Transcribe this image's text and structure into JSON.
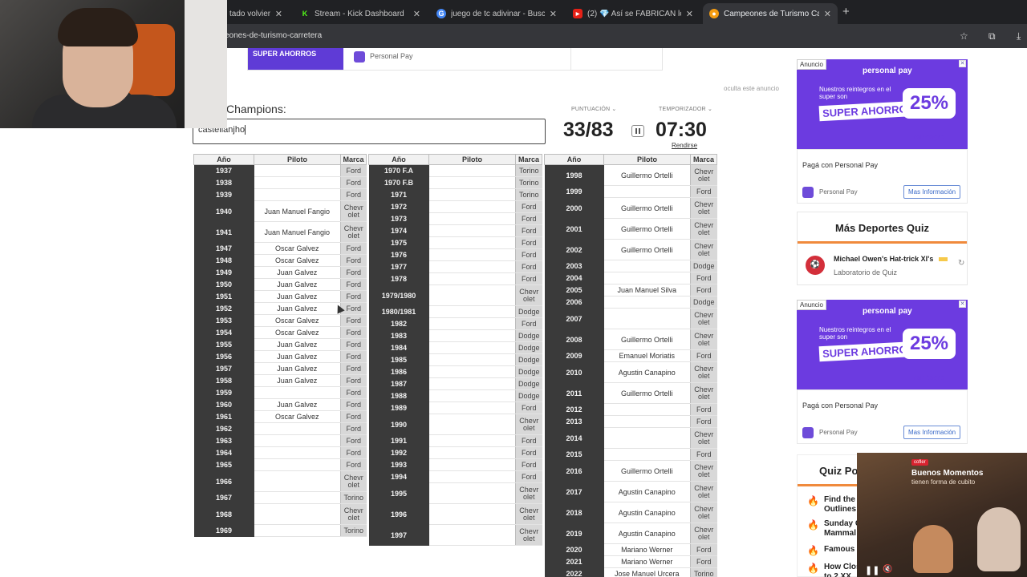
{
  "browser": {
    "tabs": [
      {
        "label": "tado volviend",
        "active": false,
        "icon": "music-icon"
      },
      {
        "label": "Stream - Kick Dashboard",
        "active": false,
        "icon": "kick-icon"
      },
      {
        "label": "juego de tc adivinar - Buscar co",
        "active": false,
        "icon": "google-icon"
      },
      {
        "label": "(2) 💎 Así se FABRICAN los CO",
        "active": false,
        "icon": "youtube-icon"
      },
      {
        "label": "Campeones de Turismo Carrete",
        "active": true,
        "icon": "sporcle-icon"
      }
    ],
    "url": "eones-de-turismo-carretera"
  },
  "top_ad": {
    "image_text": "SUPER AHORROS",
    "brand": "Personal Pay",
    "hide_label": "oculta este anuncio"
  },
  "quiz": {
    "prompt": "Champions:",
    "answer_value": "castellanjho",
    "score_label": "PUNTUACIÓN",
    "score": "33/83",
    "timer_label": "TEMPORIZADOR",
    "timer": "07:30",
    "give_up": "Rendirse",
    "headers": {
      "year": "Año",
      "driver": "Piloto",
      "brand": "Marca"
    },
    "tables": [
      [
        {
          "y": "1937",
          "d": "",
          "b": "Ford",
          "h": 15
        },
        {
          "y": "1938",
          "d": "",
          "b": "Ford",
          "h": 15
        },
        {
          "y": "1939",
          "d": "",
          "b": "Ford",
          "h": 15
        },
        {
          "y": "1940",
          "d": "Juan Manuel Fangio",
          "b": "Chevr olet",
          "h": 26
        },
        {
          "y": "1941",
          "d": "Juan Manuel Fangio",
          "b": "Chevr olet",
          "h": 26
        },
        {
          "y": "1947",
          "d": "Oscar Galvez",
          "b": "Ford",
          "h": 15
        },
        {
          "y": "1948",
          "d": "Oscar Galvez",
          "b": "Ford",
          "h": 15
        },
        {
          "y": "1949",
          "d": "Juan Galvez",
          "b": "Ford",
          "h": 15
        },
        {
          "y": "1950",
          "d": "Juan Galvez",
          "b": "Ford",
          "h": 15
        },
        {
          "y": "1951",
          "d": "Juan Galvez",
          "b": "Ford",
          "h": 15
        },
        {
          "y": "1952",
          "d": "Juan Galvez",
          "b": "Ford",
          "h": 15
        },
        {
          "y": "1953",
          "d": "Oscar Galvez",
          "b": "Ford",
          "h": 15
        },
        {
          "y": "1954",
          "d": "Oscar Galvez",
          "b": "Ford",
          "h": 15
        },
        {
          "y": "1955",
          "d": "Juan Galvez",
          "b": "Ford",
          "h": 15
        },
        {
          "y": "1956",
          "d": "Juan Galvez",
          "b": "Ford",
          "h": 15
        },
        {
          "y": "1957",
          "d": "Juan Galvez",
          "b": "Ford",
          "h": 15
        },
        {
          "y": "1958",
          "d": "Juan Galvez",
          "b": "Ford",
          "h": 15
        },
        {
          "y": "1959",
          "d": "",
          "b": "Ford",
          "h": 15
        },
        {
          "y": "1960",
          "d": "Juan Galvez",
          "b": "Ford",
          "h": 15
        },
        {
          "y": "1961",
          "d": "Oscar Galvez",
          "b": "Ford",
          "h": 15
        },
        {
          "y": "1962",
          "d": "",
          "b": "Ford",
          "h": 15
        },
        {
          "y": "1963",
          "d": "",
          "b": "Ford",
          "h": 15
        },
        {
          "y": "1964",
          "d": "",
          "b": "Ford",
          "h": 15
        },
        {
          "y": "1965",
          "d": "",
          "b": "Ford",
          "h": 15
        },
        {
          "y": "1966",
          "d": "",
          "b": "Chevr olet",
          "h": 26
        },
        {
          "y": "1967",
          "d": "",
          "b": "Torino",
          "h": 15
        },
        {
          "y": "1968",
          "d": "",
          "b": "Chevr olet",
          "h": 26
        },
        {
          "y": "1969",
          "d": "",
          "b": "Torino",
          "h": 15
        }
      ],
      [
        {
          "y": "1970 F.A",
          "d": "",
          "b": "Torino",
          "h": 15
        },
        {
          "y": "1970 F.B",
          "d": "",
          "b": "Torino",
          "h": 15
        },
        {
          "y": "1971",
          "d": "",
          "b": "Torino",
          "h": 15
        },
        {
          "y": "1972",
          "d": "",
          "b": "Ford",
          "h": 15
        },
        {
          "y": "1973",
          "d": "",
          "b": "Ford",
          "h": 15
        },
        {
          "y": "1974",
          "d": "",
          "b": "Ford",
          "h": 15
        },
        {
          "y": "1975",
          "d": "",
          "b": "Ford",
          "h": 15
        },
        {
          "y": "1976",
          "d": "",
          "b": "Ford",
          "h": 15
        },
        {
          "y": "1977",
          "d": "",
          "b": "Ford",
          "h": 15
        },
        {
          "y": "1978",
          "d": "",
          "b": "Ford",
          "h": 15
        },
        {
          "y": "1979/1980",
          "d": "",
          "b": "Chevr olet",
          "h": 26
        },
        {
          "y": "1980/1981",
          "d": "",
          "b": "Dodge",
          "h": 15
        },
        {
          "y": "1982",
          "d": "",
          "b": "Ford",
          "h": 15
        },
        {
          "y": "1983",
          "d": "",
          "b": "Dodge",
          "h": 15
        },
        {
          "y": "1984",
          "d": "",
          "b": "Dodge",
          "h": 15
        },
        {
          "y": "1985",
          "d": "",
          "b": "Dodge",
          "h": 15
        },
        {
          "y": "1986",
          "d": "",
          "b": "Dodge",
          "h": 15
        },
        {
          "y": "1987",
          "d": "",
          "b": "Dodge",
          "h": 15
        },
        {
          "y": "1988",
          "d": "",
          "b": "Dodge",
          "h": 15
        },
        {
          "y": "1989",
          "d": "",
          "b": "Ford",
          "h": 15
        },
        {
          "y": "1990",
          "d": "",
          "b": "Chevr olet",
          "h": 26
        },
        {
          "y": "1991",
          "d": "",
          "b": "Ford",
          "h": 15
        },
        {
          "y": "1992",
          "d": "",
          "b": "Ford",
          "h": 15
        },
        {
          "y": "1993",
          "d": "",
          "b": "Ford",
          "h": 15
        },
        {
          "y": "1994",
          "d": "",
          "b": "Ford",
          "h": 15
        },
        {
          "y": "1995",
          "d": "",
          "b": "Chevr olet",
          "h": 26
        },
        {
          "y": "1996",
          "d": "",
          "b": "Chevr olet",
          "h": 26
        },
        {
          "y": "1997",
          "d": "",
          "b": "Chevr olet",
          "h": 26
        }
      ],
      [
        {
          "y": "1998",
          "d": "Guillermo Ortelli",
          "b": "Chevr olet",
          "h": 26
        },
        {
          "y": "1999",
          "d": "",
          "b": "Ford",
          "h": 15
        },
        {
          "y": "2000",
          "d": "Guillermo Ortelli",
          "b": "Chevr olet",
          "h": 26
        },
        {
          "y": "2001",
          "d": "Guillermo Ortelli",
          "b": "Chevr olet",
          "h": 26
        },
        {
          "y": "2002",
          "d": "Guillermo Ortelli",
          "b": "Chevr olet",
          "h": 26
        },
        {
          "y": "2003",
          "d": "",
          "b": "Dodge",
          "h": 15
        },
        {
          "y": "2004",
          "d": "",
          "b": "Ford",
          "h": 15
        },
        {
          "y": "2005",
          "d": "Juan Manuel Silva",
          "b": "Ford",
          "h": 15
        },
        {
          "y": "2006",
          "d": "",
          "b": "Dodge",
          "h": 15
        },
        {
          "y": "2007",
          "d": "",
          "b": "Chevr olet",
          "h": 26
        },
        {
          "y": "2008",
          "d": "Guillermo Ortelli",
          "b": "Chevr olet",
          "h": 26
        },
        {
          "y": "2009",
          "d": "Emanuel Moriatis",
          "b": "Ford",
          "h": 15
        },
        {
          "y": "2010",
          "d": "Agustin Canapino",
          "b": "Chevr olet",
          "h": 26
        },
        {
          "y": "2011",
          "d": "Guillermo Ortelli",
          "b": "Chevr olet",
          "h": 26
        },
        {
          "y": "2012",
          "d": "",
          "b": "Ford",
          "h": 15
        },
        {
          "y": "2013",
          "d": "",
          "b": "Ford",
          "h": 15
        },
        {
          "y": "2014",
          "d": "",
          "b": "Chevr olet",
          "h": 26
        },
        {
          "y": "2015",
          "d": "",
          "b": "Ford",
          "h": 15
        },
        {
          "y": "2016",
          "d": "Guillermo Ortelli",
          "b": "Chevr olet",
          "h": 26
        },
        {
          "y": "2017",
          "d": "Agustin Canapino",
          "b": "Chevr olet",
          "h": 26
        },
        {
          "y": "2018",
          "d": "Agustin Canapino",
          "b": "Chevr olet",
          "h": 26
        },
        {
          "y": "2019",
          "d": "Agustin Canapino",
          "b": "Chevr olet",
          "h": 26
        },
        {
          "y": "2020",
          "d": "Mariano Werner",
          "b": "Ford",
          "h": 15
        },
        {
          "y": "2021",
          "d": "Mariano Werner",
          "b": "Ford",
          "h": 15
        },
        {
          "y": "2022",
          "d": "Jose Manuel Urcera",
          "b": "Torino",
          "h": 15
        }
      ]
    ]
  },
  "sidebar": {
    "ad": {
      "tag": "Anuncio",
      "brand": "personal pay",
      "line1": "Nuestros reintegros en el super son",
      "big": "SUPER AHORROS",
      "pct": "25%",
      "pct_sub": "reintegro",
      "caption": "Pagá con Personal Pay",
      "brand_name": "Personal Pay",
      "more": "Mas Información"
    },
    "more_sports": {
      "title": "Más Deportes Quiz",
      "quiz_title": "Michael Owen's Hat-trick XI's",
      "quiz_sub": "Laboratorio de Quiz"
    },
    "quiz_pop": {
      "title": "Quiz Po",
      "items": [
        "Find the Outlines",
        "Sunday C Mammal",
        "Famous",
        "How Clos to 2 XX"
      ]
    }
  },
  "video": {
    "logo": "cofler",
    "title": "Buenos Momentos",
    "subtitle": "tienen forma de cubito"
  },
  "colors": {
    "dark_year": "#3a3a3a",
    "brand_bg": "#d8d8d8",
    "accent": "#6c3be0",
    "orange": "#f08a3c"
  }
}
